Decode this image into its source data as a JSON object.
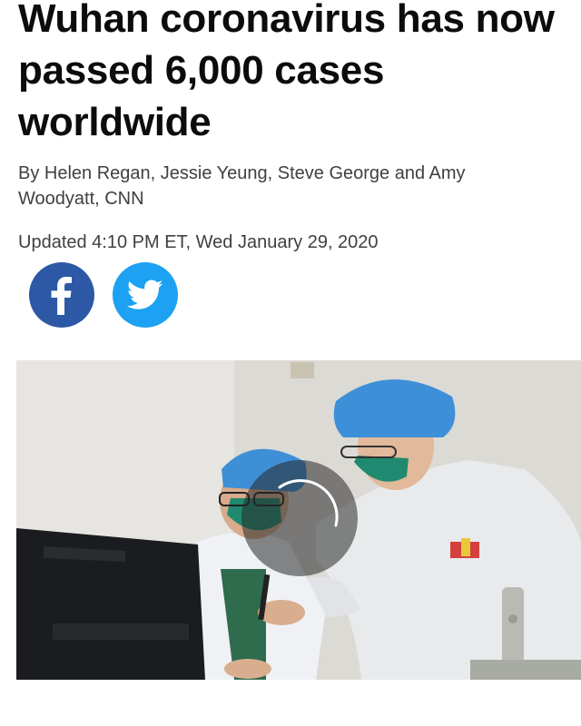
{
  "article": {
    "headline_lines": [
      "Wuhan coronavirus has now",
      "passed 6,000 cases",
      "worldwide"
    ],
    "byline": "By Helen Regan, Jessie Yeung, Steve George and Amy Woodyatt, CNN",
    "updated": "Updated 4:10 PM ET, Wed January 29, 2020"
  },
  "share": {
    "facebook_icon": "facebook-icon",
    "twitter_icon": "twitter-icon",
    "facebook_color": "#2d58a6",
    "twitter_color": "#1da1f2"
  },
  "video": {
    "loading_indicator": "spinner-icon"
  }
}
